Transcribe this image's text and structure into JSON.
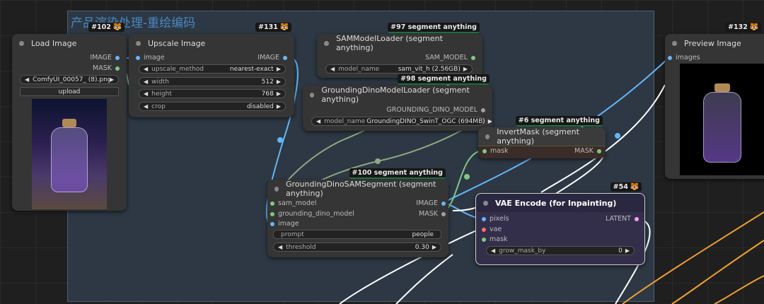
{
  "group": {
    "title": "产品渲染处理-重绘编码"
  },
  "nodes": {
    "load_image": {
      "badge": "#102 🐯",
      "title": "Load Image",
      "outputs": [
        "IMAGE",
        "MASK"
      ],
      "image_value": "ComfyUI_00057_ (8).png",
      "upload_label": "upload"
    },
    "upscale": {
      "badge": "#131 🐯",
      "title": "Upscale Image",
      "input": "image",
      "output": "IMAGE",
      "widgets": [
        {
          "label": "upscale_method",
          "value": "nearest-exact"
        },
        {
          "label": "width",
          "value": "512"
        },
        {
          "label": "height",
          "value": "768"
        },
        {
          "label": "crop",
          "value": "disabled"
        }
      ]
    },
    "sam_loader": {
      "badge": "#97 segment anything",
      "title": "SAMModelLoader (segment anything)",
      "output": "SAM_MODEL",
      "widget": {
        "label": "model_name",
        "value": "sam_vit_h (2.56GB)"
      }
    },
    "dino_loader": {
      "badge": "#98 segment anything",
      "title": "GroundingDinoModelLoader (segment anything)",
      "output": "GROUNDING_DINO_MODEL",
      "widget": {
        "label": "model_name",
        "value": "GroundingDINO_SwinT_OGC (694MB)"
      }
    },
    "invert_mask": {
      "badge": "#6 segment anything",
      "title": "InvertMask (segment anything)",
      "input": "mask",
      "output": "MASK"
    },
    "dino_sam": {
      "badge": "#100 segment anything",
      "title": "GroundingDinoSAMSegment (segment anything)",
      "inputs": [
        "sam_model",
        "grounding_dino_model",
        "image"
      ],
      "outputs": [
        "IMAGE",
        "MASK"
      ],
      "prompt": {
        "label": "prompt",
        "value": "people"
      },
      "threshold": {
        "label": "threshold",
        "value": "0.30"
      }
    },
    "vae_encode": {
      "badge": "#54 🐯",
      "title": "VAE Encode (for Inpainting)",
      "inputs": [
        "pixels",
        "vae",
        "mask"
      ],
      "output": "LATENT",
      "widget": {
        "label": "grow_mask_by",
        "value": "0"
      }
    },
    "preview": {
      "badge": "#132 🐯",
      "title": "Preview Image",
      "input": "images"
    }
  }
}
